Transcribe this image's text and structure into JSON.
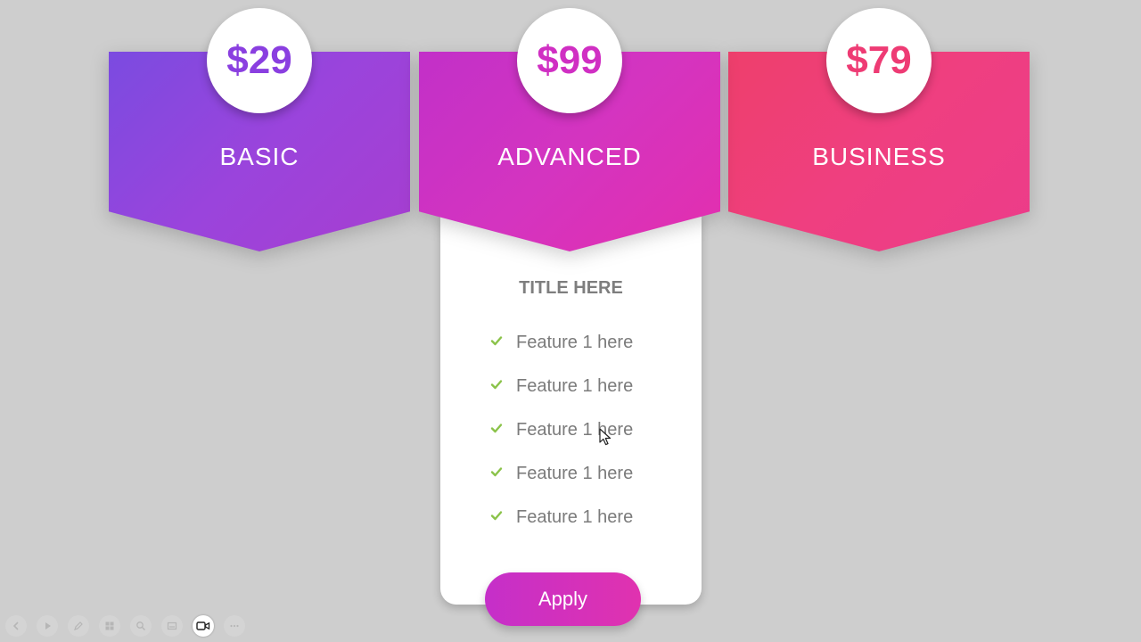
{
  "plans": [
    {
      "id": "basic",
      "price": "$29",
      "name": "BASIC"
    },
    {
      "id": "advanced",
      "price": "$99",
      "name": "ADVANCED"
    },
    {
      "id": "business",
      "price": "$79",
      "name": "BUSINESS"
    }
  ],
  "panel": {
    "title": "TITLE HERE",
    "features": [
      "Feature 1 here",
      "Feature 1 here",
      "Feature 1 here",
      "Feature 1 here",
      "Feature 1 here"
    ],
    "apply_label": "Apply"
  },
  "icons": {
    "check": "check-icon",
    "cursor": "mouse-pointer-icon",
    "toolbar": [
      "previous-icon",
      "play-icon",
      "pen-icon",
      "slides-icon",
      "zoom-icon",
      "subtitles-icon",
      "video-camera-icon",
      "more-icon"
    ]
  },
  "colors": {
    "background": "#cecece",
    "basic": "#8a3fe0",
    "advanced": "#d02fc3",
    "business": "#ee3b74",
    "check": "#8bc34a",
    "feature_text": "#7b7b7b"
  }
}
